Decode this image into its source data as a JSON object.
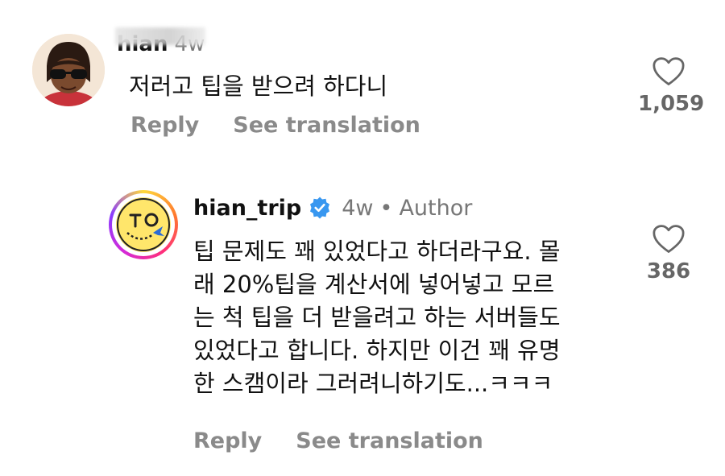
{
  "comments": [
    {
      "username": "hian",
      "time": "4w",
      "text": "저러고 팁을 받으려 하다니",
      "reply_label": "Reply",
      "translate_label": "See translation",
      "like_count": "1,059",
      "like_icon": "heart-outline-icon"
    },
    {
      "username": "hian_trip",
      "verified_icon": "verified-badge-icon",
      "time": "4w",
      "separator": "•",
      "author_label": "Author",
      "text_lines": [
        "팁 문제도 꽤 있었다고 하더라구요. 몰",
        "래 20%팁을 계산서에 넣어넣고 모르",
        "는 척 팁을 더 받을려고 하는 서버들도",
        "있었다고 합니다. 하지만 이건 꽤 유명",
        "한 스캠이라 그러려니하기도...ㅋㅋㅋ"
      ],
      "reply_label": "Reply",
      "translate_label": "See translation",
      "like_count": "386",
      "like_icon": "heart-outline-icon"
    }
  ],
  "colors": {
    "verified_blue": "#3897f0",
    "muted_text": "#8a8a8a"
  }
}
